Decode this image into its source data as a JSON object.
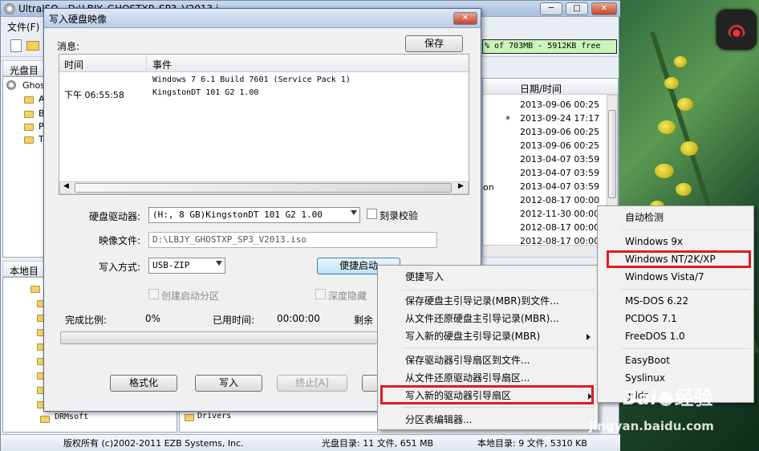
{
  "app": {
    "title": "UltraISO - D:\\LBJY_GHOSTXP_SP3_V2013.i",
    "menu_file": "文件(F)",
    "capacity": "% of 703MB - 5912KB free",
    "cd_dir_label": "光盘目录",
    "local_dir_label": "本地目",
    "tree_root": "Ghos",
    "tree_items": [
      "A",
      "B",
      "P",
      "T"
    ],
    "date_header": "日期/时间",
    "dates": [
      "2013-09-06 00:25",
      "2013-09-24 17:17",
      "2013-09-06 00:25",
      "2013-09-06 00:25",
      "2013-04-07 03:59",
      "2013-04-07 03:59",
      "2013-04-07 03:59",
      "2012-08-17 00:00",
      "2012-11-30 00:00",
      "2012-08-17 00:00",
      "2012-08-17 00:00"
    ],
    "star_mark": "*",
    "on_fragment": "on",
    "local_folder_1": "DRMsoft",
    "local_folder_2": "Drivers"
  },
  "status": {
    "copyright": "版权所有 (c)2002-2011 EZB Systems, Inc.",
    "cd_info": "光盘目录: 11 文件, 651 MB",
    "local_info": "本地目录: 9 文件, 5310 KB"
  },
  "dialog": {
    "title": "写入硬盘映像",
    "messages_label": "消息:",
    "save_button": "保存",
    "col_time": "时间",
    "col_event": "事件",
    "log_time": "下午 06:55:58",
    "log_line1": "Windows 7 6.1 Build 7601 (Service Pack 1)",
    "log_line2": "KingstonDT 101 G2       1.00",
    "drive_label": "硬盘驱动器:",
    "drive_value": "(H:, 8 GB)KingstonDT 101 G2        1.00",
    "verify_label": "刻录校验",
    "image_label": "映像文件:",
    "image_value": "D:\\LBJY_GHOSTXP_SP3_V2013.iso",
    "method_label": "写入方式:",
    "method_value": "USB-ZIP",
    "quickboot_button": "便捷启动",
    "create_partition_label": "创建启动分区",
    "deep_hide_label": "深度隐藏",
    "progress_label": "完成比例:",
    "progress_value": "0%",
    "progress_fraction": 0,
    "elapsed_label": "已用时间:",
    "elapsed_value": "00:00:00",
    "remaining_label": "剩余",
    "format_button": "格式化",
    "write_button": "写入",
    "stop_button": "终止[A]"
  },
  "context_menu": {
    "items": [
      "便捷写入",
      "保存硬盘主引导记录(MBR)到文件...",
      "从文件还原硬盘主引导记录(MBR)...",
      "写入新的硬盘主引导记录(MBR)",
      "保存驱动器引导扇区到文件...",
      "从文件还原驱动器引导扇区...",
      "写入新的驱动器引导扇区",
      "分区表编辑器..."
    ]
  },
  "submenu": {
    "items": [
      "自动检测",
      "Windows 9x",
      "Windows NT/2K/XP",
      "Windows Vista/7",
      "MS-DOS 6.22",
      "PCDOS 7.1",
      "FreeDOS 1.0",
      "EasyBoot",
      "Syslinux",
      "grldr"
    ]
  },
  "watermark": {
    "brand": "Bai",
    "brand_suffix": "经验",
    "url": "jingyan.baidu.com"
  },
  "colors": {
    "highlight_box": "#e21b1b",
    "title_blue": "#b9cce6"
  }
}
